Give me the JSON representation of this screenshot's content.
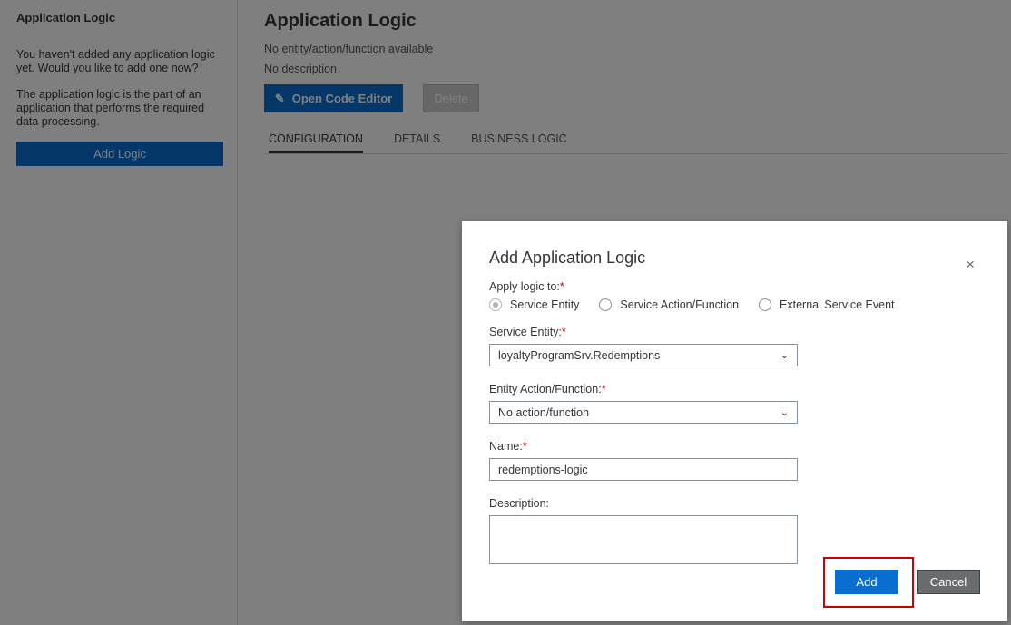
{
  "sidebar": {
    "title": "Application Logic",
    "intro": "You haven't added any application logic yet. Would you like to add one now?",
    "description": "The application logic is the part of an application that performs the required data processing.",
    "add_button": "Add Logic"
  },
  "main": {
    "title": "Application Logic",
    "entity_info": "No entity/action/function available",
    "description": "No description",
    "open_editor_button": "Open Code Editor",
    "delete_button": "Delete",
    "tabs": [
      {
        "label": "CONFIGURATION",
        "active": true
      },
      {
        "label": "DETAILS",
        "active": false
      },
      {
        "label": "BUSINESS LOGIC",
        "active": false
      }
    ]
  },
  "dialog": {
    "title": "Add Application Logic",
    "close": "×",
    "apply_label": "Apply logic to:",
    "required_mark": "*",
    "radios": [
      "Service Entity",
      "Service Action/Function",
      "External Service Event"
    ],
    "service_entity_label": "Service Entity:",
    "service_entity_value": "loyaltyProgramSrv.Redemptions",
    "entity_action_label": "Entity Action/Function:",
    "entity_action_value": "No action/function",
    "name_label": "Name:",
    "name_value": "redemptions-logic",
    "description_label": "Description:",
    "add_button": "Add",
    "cancel_button": "Cancel"
  }
}
